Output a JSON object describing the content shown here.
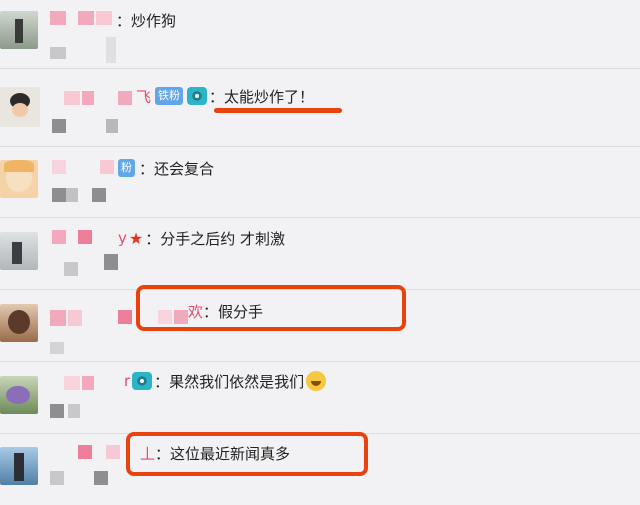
{
  "comments": [
    {
      "name_fragment": "",
      "text": "：炒作狗"
    },
    {
      "name_fragment": "飞",
      "badge": "铁粉",
      "text": "：太能炒作了！"
    },
    {
      "name_fragment": "",
      "badge": "粉",
      "text": "：还会复合"
    },
    {
      "name_fragment": "y",
      "text": "：分手之后约 才刺激"
    },
    {
      "name_fragment": "欢",
      "text": "：假分手"
    },
    {
      "name_fragment": "",
      "text": "：果然我们依然是我们"
    },
    {
      "name_fragment": "丄",
      "text": "：这位最近新闻真多"
    }
  ],
  "icons": {
    "camera": "camera-icon",
    "star": "star-icon",
    "laugh": "laugh-cry-emoji-icon"
  },
  "colors": {
    "highlight": "#e8420f",
    "badge": "#63a6e8",
    "mosaic_pink": "#f3a9bd",
    "mosaic_gray": "#a6a6a8"
  }
}
